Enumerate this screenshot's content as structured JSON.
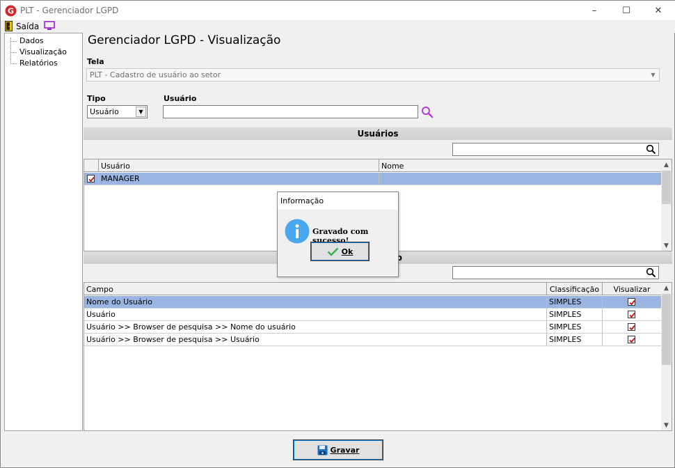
{
  "window": {
    "title": "PLT - Gerenciador LGPD",
    "minimize": "–",
    "maximize": "☐",
    "close": "✕"
  },
  "menu": {
    "exit_label": "Saída"
  },
  "tree": {
    "items": [
      "Dados",
      "Visualização",
      "Relatórios"
    ]
  },
  "main": {
    "title": "Gerenciador LGPD - Visualização",
    "tela_label": "Tela",
    "tela_value": "PLT - Cadastro de usuário ao setor",
    "tipo_label": "Tipo",
    "tipo_value": "Usuário",
    "usuario_label": "Usuário",
    "usuario_value": ""
  },
  "users_section": {
    "title": "Usuários",
    "filter_value": "",
    "columns": [
      "Usuário",
      "Nome"
    ],
    "rows": [
      {
        "usuario": "MANAGER",
        "nome": "",
        "checked": true
      }
    ]
  },
  "fields_section": {
    "title": "o",
    "filter_value": "",
    "columns": [
      "Campo",
      "Classificação",
      "Visualizar"
    ],
    "rows": [
      {
        "campo": "Nome do Usuário",
        "classificacao": "SIMPLES",
        "visualizar": true
      },
      {
        "campo": "Usuário",
        "classificacao": "SIMPLES",
        "visualizar": true
      },
      {
        "campo": "Usuário >> Browser de pesquisa >> Nome do usuário",
        "classificacao": "SIMPLES",
        "visualizar": true
      },
      {
        "campo": "Usuário >> Browser de pesquisa >> Usuário",
        "classificacao": "SIMPLES",
        "visualizar": true
      }
    ]
  },
  "dialog": {
    "title": "Informação",
    "message": "Gravado com sucesso!",
    "ok_label": "Ok"
  },
  "footer": {
    "save_label": "Gravar"
  },
  "colors": {
    "selection": "#9bb5e3",
    "info_icon": "#4aa8ee",
    "check_red": "#d01010",
    "save_icon": "#1a6fc4"
  }
}
